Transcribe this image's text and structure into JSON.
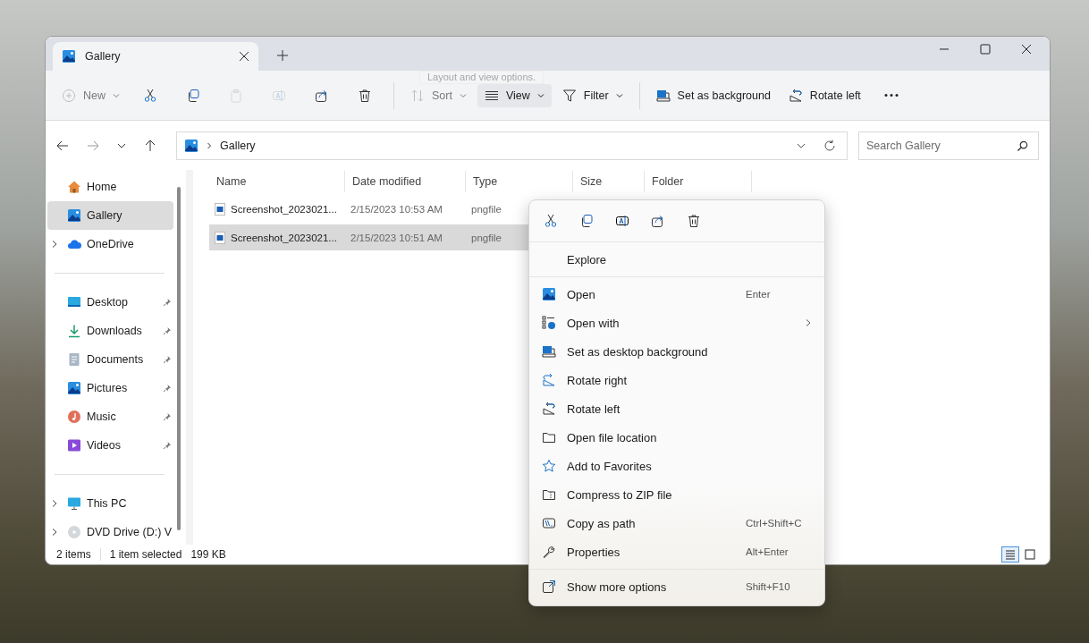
{
  "window": {
    "tab": {
      "title": "Gallery",
      "selected": true
    }
  },
  "toolbar": [
    {
      "kind": "new",
      "label": "New",
      "disabled": true,
      "dropdown": true
    },
    {
      "kind": "cut",
      "disabled": false
    },
    {
      "kind": "copy",
      "disabled": false
    },
    {
      "kind": "paste",
      "disabled": true
    },
    {
      "kind": "rename",
      "disabled": true
    },
    {
      "kind": "share",
      "disabled": false
    },
    {
      "kind": "delete",
      "disabled": false
    },
    {
      "kind": "separator"
    },
    {
      "kind": "sort",
      "label": "Sort",
      "disabled": true,
      "dropdown": true
    },
    {
      "kind": "view",
      "label": "View",
      "disabled": false,
      "dropdown": true,
      "hovered": true
    },
    {
      "kind": "filter",
      "label": "Filter",
      "disabled": false,
      "dropdown": true
    },
    {
      "kind": "separator"
    },
    {
      "kind": "background",
      "label": "Set as background",
      "disabled": false
    },
    {
      "kind": "rotate-left",
      "label": "Rotate left",
      "disabled": false
    },
    {
      "kind": "more",
      "disabled": false
    }
  ],
  "tooltip": "Layout and view options.",
  "address": {
    "path": "Gallery"
  },
  "search": {
    "placeholder": "Search Gallery"
  },
  "sidebar": {
    "groups": [
      [
        {
          "kind": "home",
          "label": "Home",
          "selected": false,
          "expandable": false,
          "pinned": false
        },
        {
          "kind": "gallery",
          "label": "Gallery",
          "selected": true,
          "expandable": false,
          "pinned": false
        },
        {
          "kind": "onedrive",
          "label": "OneDrive",
          "selected": false,
          "expandable": true,
          "pinned": false
        }
      ],
      [
        {
          "kind": "desktop",
          "label": "Desktop",
          "selected": false,
          "expandable": false,
          "pinned": true
        },
        {
          "kind": "downloads",
          "label": "Downloads",
          "selected": false,
          "expandable": false,
          "pinned": true
        },
        {
          "kind": "documents",
          "label": "Documents",
          "selected": false,
          "expandable": false,
          "pinned": true
        },
        {
          "kind": "pictures",
          "label": "Pictures",
          "selected": false,
          "expandable": false,
          "pinned": true
        },
        {
          "kind": "music",
          "label": "Music",
          "selected": false,
          "expandable": false,
          "pinned": true
        },
        {
          "kind": "videos",
          "label": "Videos",
          "selected": false,
          "expandable": false,
          "pinned": true
        }
      ],
      [
        {
          "kind": "pc",
          "label": "This PC",
          "selected": false,
          "expandable": true,
          "pinned": false
        },
        {
          "kind": "dvd",
          "label": "DVD Drive (D:) V",
          "selected": false,
          "expandable": true,
          "pinned": false
        }
      ]
    ]
  },
  "table": {
    "columns": [
      "Name",
      "Date modified",
      "Type",
      "Size",
      "Folder"
    ],
    "rows": [
      {
        "name": "Screenshot_2023021...",
        "date": "2/15/2023 10:53 AM",
        "type": "pngfile",
        "selected": false
      },
      {
        "name": "Screenshot_2023021...",
        "date": "2/15/2023 10:51 AM",
        "type": "pngfile",
        "selected": true
      }
    ]
  },
  "status_bar": {
    "count": "2 items",
    "selection": "1 item selected",
    "size": "199 KB",
    "views": [
      {
        "kind": "details",
        "selected": true
      },
      {
        "kind": "tiles",
        "selected": false
      }
    ]
  },
  "context_menu": {
    "quick_actions": [
      {
        "kind": "cut"
      },
      {
        "kind": "copy"
      },
      {
        "kind": "rename"
      },
      {
        "kind": "share"
      },
      {
        "kind": "delete"
      }
    ],
    "sections": [
      [
        {
          "kind": "none",
          "label": "Explore"
        }
      ],
      [
        {
          "kind": "open",
          "label": "Open",
          "shortcut": "Enter"
        },
        {
          "kind": "open-with",
          "label": "Open with",
          "submenu": true
        },
        {
          "kind": "background",
          "label": "Set as desktop background"
        },
        {
          "kind": "rotate-right",
          "label": "Rotate right"
        },
        {
          "kind": "rotate-left",
          "label": "Rotate left"
        },
        {
          "kind": "folder",
          "label": "Open file location"
        },
        {
          "kind": "star",
          "label": "Add to Favorites"
        },
        {
          "kind": "zip",
          "label": "Compress to ZIP file"
        },
        {
          "kind": "path",
          "label": "Copy as path",
          "shortcut": "Ctrl+Shift+C"
        },
        {
          "kind": "wrench",
          "label": "Properties",
          "shortcut": "Alt+Enter"
        }
      ],
      [
        {
          "kind": "more-options",
          "label": "Show more options",
          "shortcut": "Shift+F10"
        }
      ]
    ]
  }
}
